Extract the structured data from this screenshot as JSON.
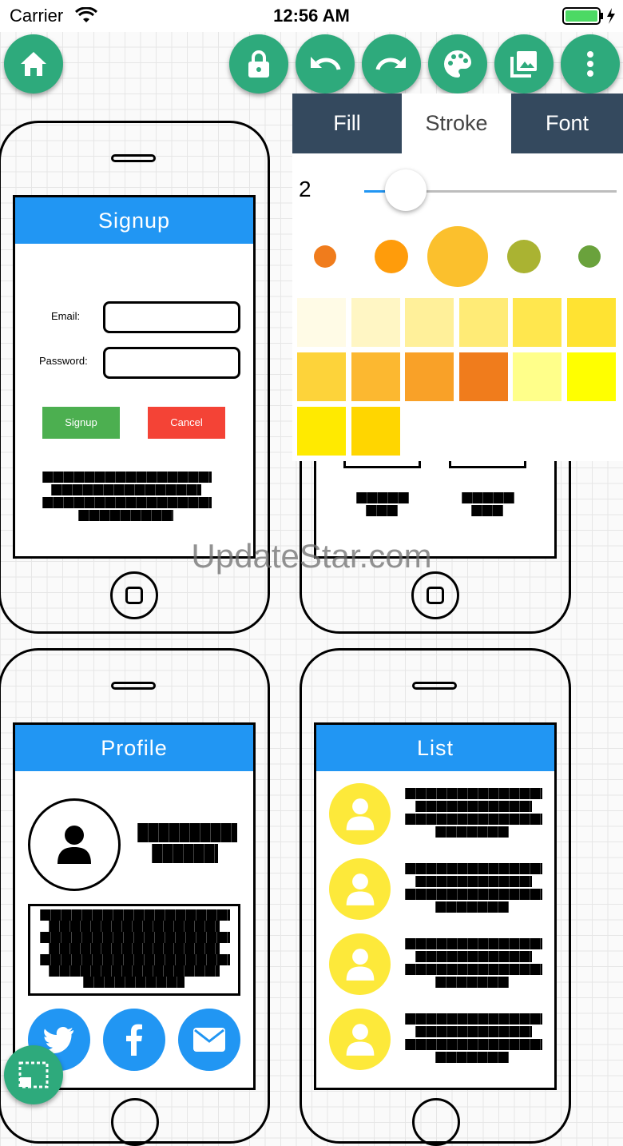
{
  "status_bar": {
    "carrier": "Carrier",
    "time": "12:56 AM"
  },
  "toolbar": {
    "buttons": [
      "home-icon",
      "lock-icon",
      "undo-icon",
      "redo-icon",
      "palette-icon",
      "images-icon",
      "more-icon"
    ],
    "accent": "#2eaa7c"
  },
  "phones": {
    "signup": {
      "title": "Signup",
      "email_label": "Email:",
      "password_label": "Password:",
      "email_value": "",
      "password_value": "",
      "signup_button": "Signup",
      "cancel_button": "Cancel",
      "signup_color": "#4caf50",
      "cancel_color": "#f44336"
    },
    "profile": {
      "title": "Profile"
    },
    "list": {
      "title": "List"
    }
  },
  "style_panel": {
    "tabs": [
      {
        "label": "Fill"
      },
      {
        "label": "Stroke"
      },
      {
        "label": "Font"
      }
    ],
    "active_tab": "Stroke",
    "stroke_width": "2",
    "stroke_slider": {
      "value": 2
    },
    "dot_colors": [
      "#f07c1c",
      "#ff9c0b",
      "#fbc02d",
      "#aab332",
      "#6aa23c"
    ],
    "swatches": [
      "#fffbe6",
      "#fff6c4",
      "#fff09a",
      "#ffeb76",
      "#ffe74e",
      "#ffe332",
      "#fdd33a",
      "#fcb830",
      "#f9a128",
      "#f07c1c",
      "#ffff8a",
      "#ffff00",
      "#ffea00",
      "#ffd600"
    ]
  },
  "watermark": "UpdateStar.com"
}
